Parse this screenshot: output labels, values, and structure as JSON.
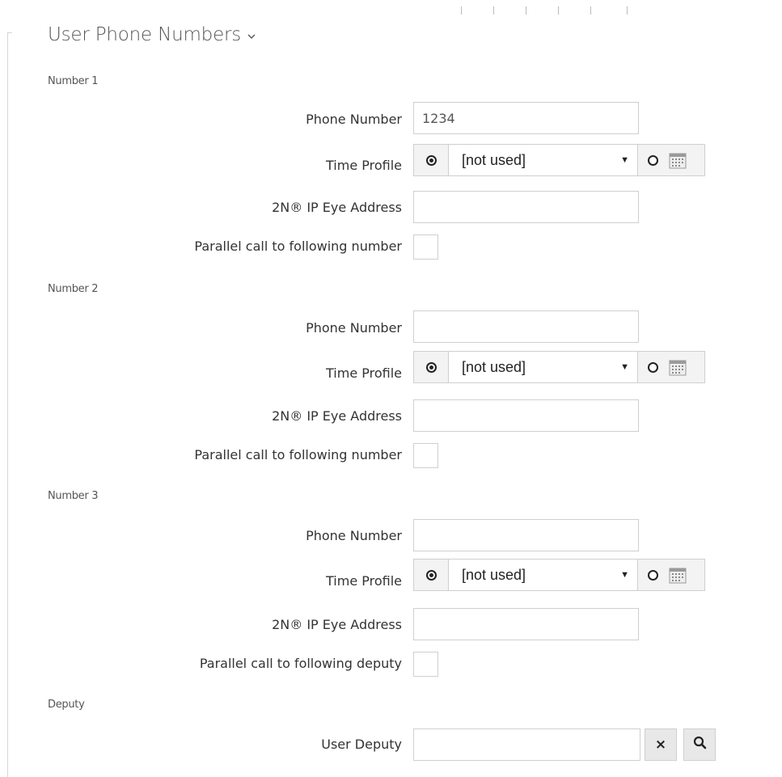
{
  "section": {
    "title": "User Phone Numbers"
  },
  "numbers": [
    {
      "group_label": "Number 1",
      "phone_label": "Phone Number",
      "phone_value": "1234",
      "time_profile_label": "Time Profile",
      "time_profile_value": "[not used]",
      "eye_label": "2N® IP Eye Address",
      "eye_value": "",
      "parallel_label": "Parallel call to following number"
    },
    {
      "group_label": "Number 2",
      "phone_label": "Phone Number",
      "phone_value": "",
      "time_profile_label": "Time Profile",
      "time_profile_value": "[not used]",
      "eye_label": "2N® IP Eye Address",
      "eye_value": "",
      "parallel_label": "Parallel call to following number"
    },
    {
      "group_label": "Number 3",
      "phone_label": "Phone Number",
      "phone_value": "",
      "time_profile_label": "Time Profile",
      "time_profile_value": "[not used]",
      "eye_label": "2N® IP Eye Address",
      "eye_value": "",
      "parallel_label": "Parallel call to following deputy"
    }
  ],
  "deputy": {
    "group_label": "Deputy",
    "user_deputy_label": "User Deputy",
    "user_deputy_value": "",
    "clear_glyph": "×"
  },
  "icons": {
    "section_toggle": "chevron-down-icon",
    "calendar": "calendar-icon",
    "clear": "close-icon",
    "search": "search-icon"
  },
  "colors": {
    "border": "#cfcfcf",
    "control_bg": "#f3f3f3",
    "button_bg": "#e8e8e8",
    "label_text": "#333333"
  }
}
